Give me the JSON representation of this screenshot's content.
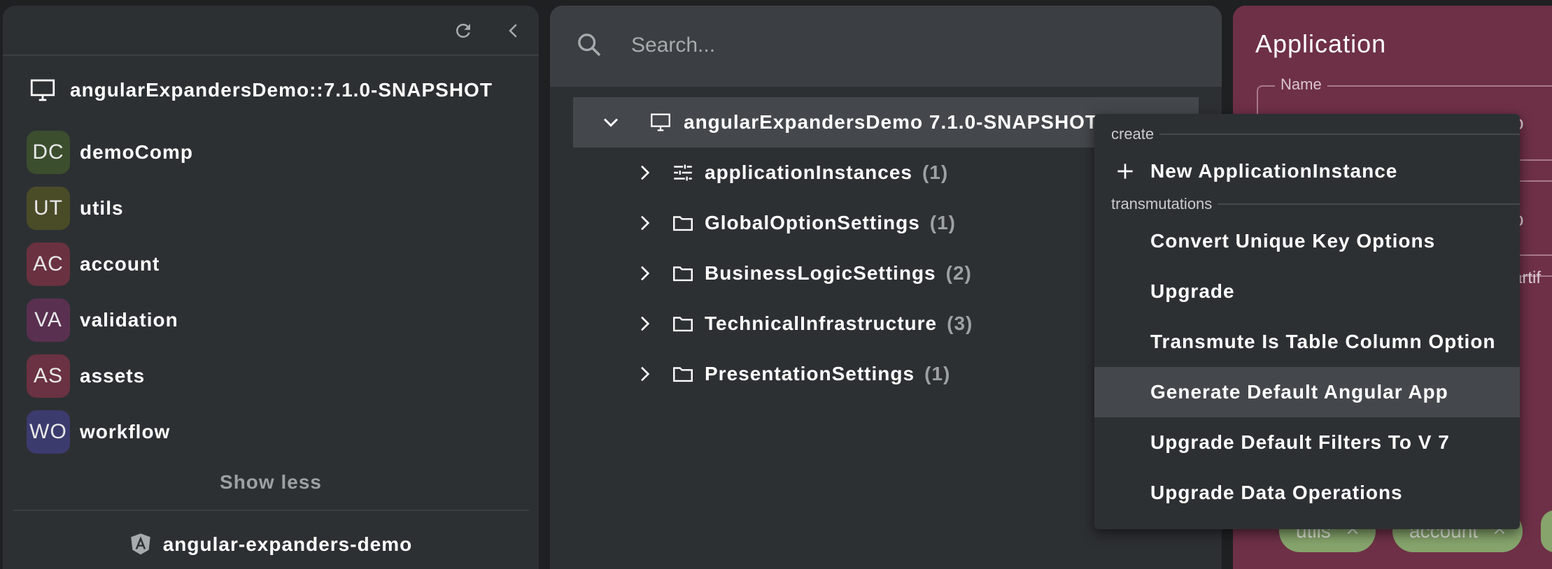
{
  "sidebar": {
    "project_title": "angularExpandersDemo::7.1.0-SNAPSHOT",
    "components": [
      {
        "abbr": "DC",
        "label": "demoComp",
        "color": "#3b4e2e"
      },
      {
        "abbr": "UT",
        "label": "utils",
        "color": "#4a4c28"
      },
      {
        "abbr": "AC",
        "label": "account",
        "color": "#6a3240"
      },
      {
        "abbr": "VA",
        "label": "validation",
        "color": "#5a3050"
      },
      {
        "abbr": "AS",
        "label": "assets",
        "color": "#6a3242"
      },
      {
        "abbr": "WO",
        "label": "workflow",
        "color": "#3c3b6e"
      }
    ],
    "show_less_label": "Show less",
    "footer_label": "angular-expanders-demo"
  },
  "search": {
    "placeholder": "Search..."
  },
  "tree": {
    "root_label": "angularExpandersDemo 7.1.0-SNAPSHOT",
    "children": [
      {
        "label": "applicationInstances",
        "count": "(1)",
        "icon": "tune-icon"
      },
      {
        "label": "GlobalOptionSettings",
        "count": "(1)",
        "icon": "folder-icon"
      },
      {
        "label": "BusinessLogicSettings",
        "count": "(2)",
        "icon": "folder-icon"
      },
      {
        "label": "TechnicalInfrastructure",
        "count": "(3)",
        "icon": "folder-icon"
      },
      {
        "label": "PresentationSettings",
        "count": "(1)",
        "icon": "folder-icon"
      }
    ]
  },
  "context_menu": {
    "create_section": "create",
    "create_items": [
      {
        "label": "New ApplicationInstance",
        "icon": "plus-icon"
      }
    ],
    "transmutations_section": "transmutations",
    "transmutation_items": [
      {
        "label": "Convert Unique Key Options"
      },
      {
        "label": "Upgrade"
      },
      {
        "label": "Transmute Is Table Column Option"
      },
      {
        "label": "Generate Default Angular App",
        "highlighted": true
      },
      {
        "label": "Upgrade Default Filters To V 7"
      },
      {
        "label": "Upgrade Data Operations"
      }
    ]
  },
  "detail": {
    "title": "Application",
    "name_label": "Name",
    "peek_o1": "o",
    "peek_o2": "o",
    "peek_artif": "artif",
    "chips": [
      {
        "label": "utils"
      },
      {
        "label": "account"
      }
    ]
  },
  "colors": {
    "panel_bg": "#2d3033",
    "search_bg": "#3b3f43",
    "selected_bg": "#44484c",
    "detail_bg": "#6e3047",
    "chip_bg": "#86a46c"
  }
}
